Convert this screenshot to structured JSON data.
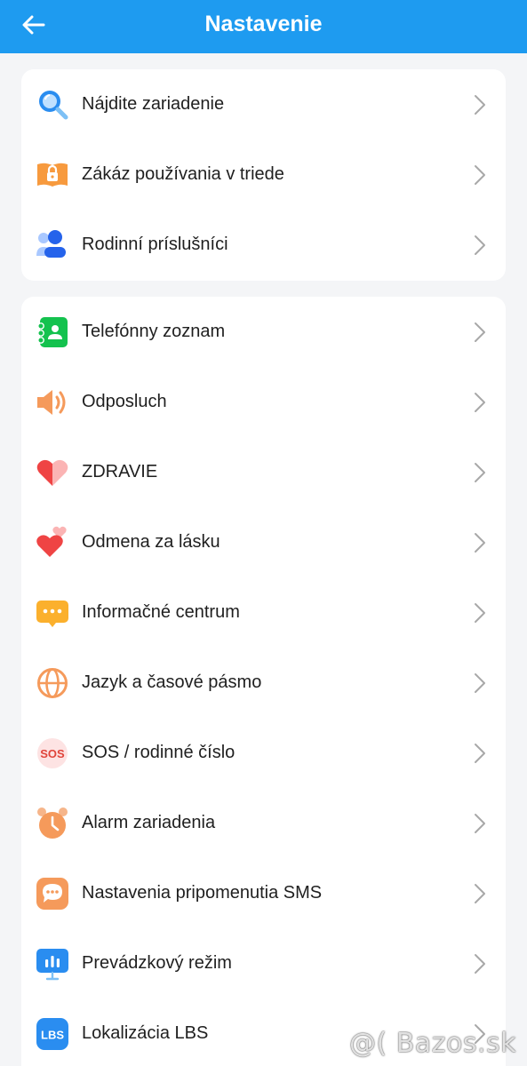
{
  "header": {
    "title": "Nastavenie",
    "back_icon": "arrow-left-icon"
  },
  "section1": {
    "items": [
      {
        "label": "Nájdite zariadenie",
        "icon": "magnifier-icon"
      },
      {
        "label": "Zákáz používania v triede",
        "icon": "book-lock-icon"
      },
      {
        "label": "Rodinní príslušníci",
        "icon": "family-members-icon"
      }
    ]
  },
  "section2": {
    "items": [
      {
        "label": "Telefónny zoznam",
        "icon": "phonebook-icon"
      },
      {
        "label": "Odposluch",
        "icon": "speaker-icon"
      },
      {
        "label": "ZDRAVIE",
        "icon": "heart-icon"
      },
      {
        "label": "Odmena za lásku",
        "icon": "hearts-icon"
      },
      {
        "label": "Informačné centrum",
        "icon": "message-dots-icon"
      },
      {
        "label": "Jazyk a časové pásmo",
        "icon": "globe-icon"
      },
      {
        "label": "SOS / rodinné číslo",
        "icon": "sos-icon",
        "badge_text": "SOS"
      },
      {
        "label": "Alarm zariadenia",
        "icon": "alarm-clock-icon"
      },
      {
        "label": "Nastavenia pripomenutia SMS",
        "icon": "sms-bubble-icon"
      },
      {
        "label": "Prevádzkový režim",
        "icon": "operating-mode-icon"
      },
      {
        "label": "Lokalizácia LBS",
        "icon": "lbs-icon",
        "badge_text": "LBS"
      }
    ]
  },
  "watermark": "@( Bazos.sk",
  "colors": {
    "header": "#1e9bf0",
    "background": "#f4f5f7",
    "card": "#ffffff",
    "chevron": "#a8a8a8"
  }
}
